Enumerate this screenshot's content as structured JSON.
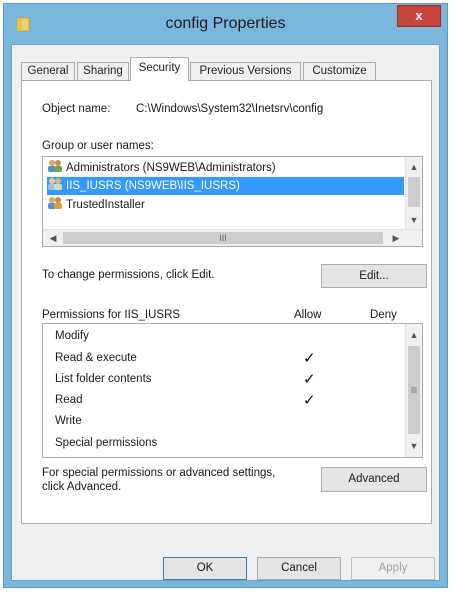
{
  "window": {
    "title": "config Properties",
    "close_label": "x"
  },
  "tabs": [
    {
      "label": "General"
    },
    {
      "label": "Sharing"
    },
    {
      "label": "Security"
    },
    {
      "label": "Previous Versions"
    },
    {
      "label": "Customize"
    }
  ],
  "object": {
    "label": "Object name:",
    "value": "C:\\Windows\\System32\\Inetsrv\\config"
  },
  "groups": {
    "label": "Group or user names:",
    "items": [
      {
        "name": "Administrators (NS9WEB\\Administrators)"
      },
      {
        "name": "IIS_IUSRS (NS9WEB\\IIS_IUSRS)"
      },
      {
        "name": "TrustedInstaller"
      }
    ],
    "hscroll_grip": "III"
  },
  "change_hint": "To change permissions, click Edit.",
  "edit_button": "Edit...",
  "permissions": {
    "header_label": "Permissions for IIS_IUSRS",
    "allow_label": "Allow",
    "deny_label": "Deny",
    "items": [
      {
        "name": "Modify",
        "allow": "",
        "deny": ""
      },
      {
        "name": "Read & execute",
        "allow": "✓",
        "deny": ""
      },
      {
        "name": "List folder contents",
        "allow": "✓",
        "deny": ""
      },
      {
        "name": "Read",
        "allow": "✓",
        "deny": ""
      },
      {
        "name": "Write",
        "allow": "",
        "deny": ""
      },
      {
        "name": "Special permissions",
        "allow": "",
        "deny": ""
      }
    ],
    "scroll_grip": "≡"
  },
  "advanced": {
    "hint_line1": "For special permissions or advanced settings,",
    "hint_line2": "click Advanced.",
    "button": "Advanced"
  },
  "footer": {
    "ok": "OK",
    "cancel": "Cancel",
    "apply": "Apply"
  },
  "colors": {
    "frame": "#7bb7dc",
    "close": "#c6443b",
    "selection": "#3399ff"
  }
}
